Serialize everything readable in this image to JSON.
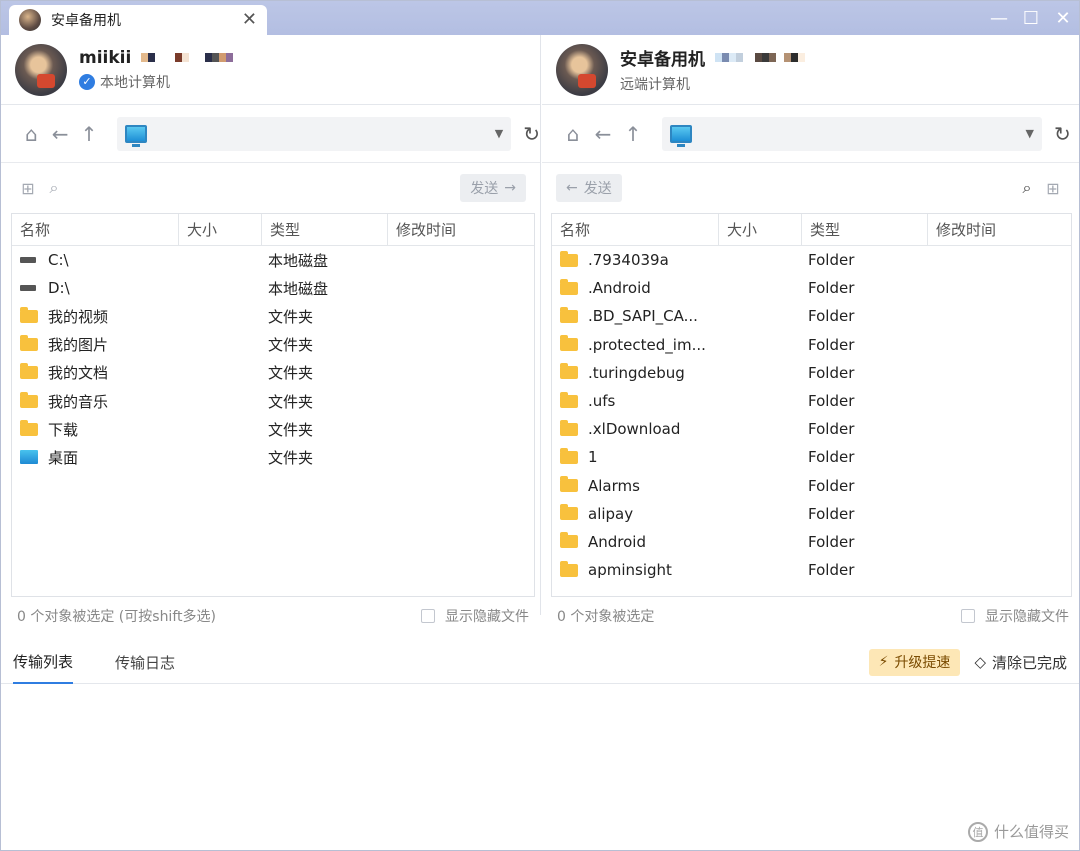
{
  "window": {
    "tab_title": "安卓备用机",
    "close": "✕",
    "min": "—",
    "max": "☐",
    "exit": "✕"
  },
  "left": {
    "user_name": "miikii",
    "user_sub": "本地计算机",
    "send_label": "发送",
    "columns": [
      "名称",
      "大小",
      "类型",
      "修改时间"
    ],
    "rows": [
      {
        "name": "C:\\",
        "type": "本地磁盘",
        "icon": "drive"
      },
      {
        "name": "D:\\",
        "type": "本地磁盘",
        "icon": "drive"
      },
      {
        "name": "我的视频",
        "type": "文件夹",
        "icon": "folder"
      },
      {
        "name": "我的图片",
        "type": "文件夹",
        "icon": "folder"
      },
      {
        "name": "我的文档",
        "type": "文件夹",
        "icon": "folder"
      },
      {
        "name": "我的音乐",
        "type": "文件夹",
        "icon": "folder"
      },
      {
        "name": "下载",
        "type": "文件夹",
        "icon": "folder"
      },
      {
        "name": "桌面",
        "type": "文件夹",
        "icon": "desktop"
      }
    ],
    "status": "0 个对象被选定 (可按shift多选)",
    "show_hidden": "显示隐藏文件"
  },
  "right": {
    "user_name": "安卓备用机",
    "user_sub": "远端计算机",
    "send_label": "发送",
    "columns": [
      "名称",
      "大小",
      "类型",
      "修改时间"
    ],
    "rows": [
      {
        "name": ".7934039a",
        "type": "Folder"
      },
      {
        "name": ".Android",
        "type": "Folder"
      },
      {
        "name": ".BD_SAPI_CA...",
        "type": "Folder"
      },
      {
        "name": ".protected_im...",
        "type": "Folder"
      },
      {
        "name": ".turingdebug",
        "type": "Folder"
      },
      {
        "name": ".ufs",
        "type": "Folder"
      },
      {
        "name": ".xlDownload",
        "type": "Folder"
      },
      {
        "name": "1",
        "type": "Folder"
      },
      {
        "name": "Alarms",
        "type": "Folder"
      },
      {
        "name": "alipay",
        "type": "Folder"
      },
      {
        "name": "Android",
        "type": "Folder"
      },
      {
        "name": "apminsight",
        "type": "Folder"
      }
    ],
    "status": "0 个对象被选定",
    "show_hidden": "显示隐藏文件"
  },
  "bottom": {
    "tab_transfer_list": "传输列表",
    "tab_transfer_log": "传输日志",
    "upgrade": "升级提速",
    "clear_done": "清除已完成"
  },
  "watermark": "什么值得买",
  "colors": {
    "accent": "#2f7de1",
    "folder": "#f8c13d",
    "titlebar": "#b3bee2",
    "upgrade_bg": "#fde7b6"
  }
}
